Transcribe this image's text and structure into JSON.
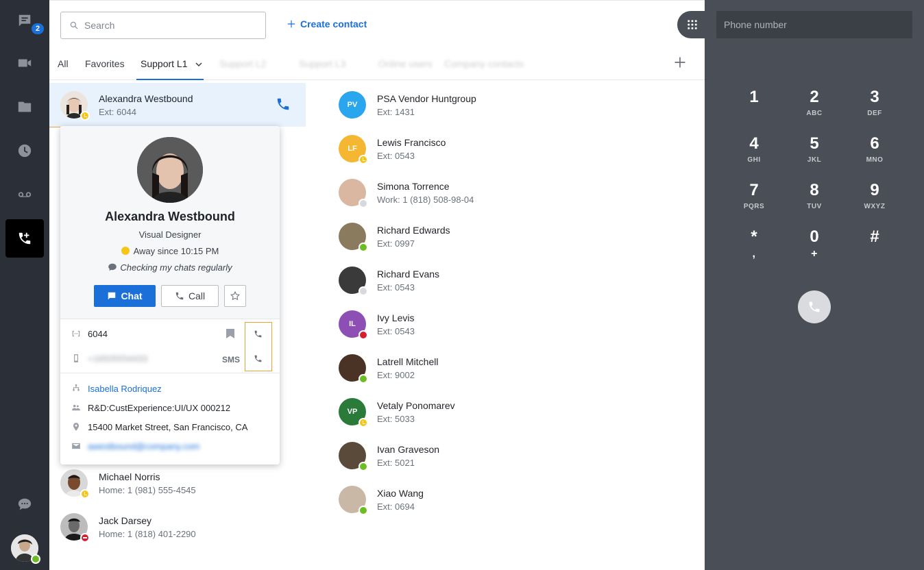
{
  "rail": {
    "chat_badge": "2"
  },
  "search": {
    "placeholder": "Search"
  },
  "create_contact": "Create contact",
  "tabs": [
    {
      "label": "All"
    },
    {
      "label": "Favorites"
    },
    {
      "label": "Support L1"
    },
    {
      "label": "Support L2"
    },
    {
      "label": "Support L3"
    },
    {
      "label": "Online users"
    },
    {
      "label": "Company contacts"
    }
  ],
  "left_contacts": [
    {
      "name": "Alexandra Westbound",
      "sub": "Ext: 6044",
      "status": "away"
    },
    {
      "name": "Michael Norris",
      "sub": "Home: 1 (981) 555-4545",
      "status": "away"
    },
    {
      "name": "Jack Darsey",
      "sub": "Home: 1 (818) 401-2290",
      "status": "dnd"
    }
  ],
  "right_contacts": [
    {
      "initials": "PV",
      "name": "PSA Vendor Huntgroup",
      "sub": "Ext: 1431",
      "color": "#2aa6ee",
      "status": "none"
    },
    {
      "initials": "LF",
      "name": "Lewis Francisco",
      "sub": "Ext: 0543",
      "color": "#f5b731",
      "status": "away"
    },
    {
      "initials": "",
      "name": "Simona Torrence",
      "sub": "Work: 1 (818) 508-98-04",
      "color": "#d9b7a0",
      "status": "grey"
    },
    {
      "initials": "",
      "name": "Richard Edwards",
      "sub": "Ext: 0997",
      "color": "#8a7a5e",
      "status": "green"
    },
    {
      "initials": "",
      "name": "Richard Evans",
      "sub": "Ext: 0543",
      "color": "#3a3a3a",
      "status": "grey"
    },
    {
      "initials": "IL",
      "name": "Ivy Levis",
      "sub": "Ext: 0543",
      "color": "#8e4fb5",
      "status": "call"
    },
    {
      "initials": "",
      "name": "Latrell Mitchell",
      "sub": "Ext: 9002",
      "color": "#4a3325",
      "status": "green"
    },
    {
      "initials": "VP",
      "name": "Vetaly Ponomarev",
      "sub": "Ext: 5033",
      "color": "#2a7a3a",
      "status": "away"
    },
    {
      "initials": "",
      "name": "Ivan Graveson",
      "sub": "Ext: 5021",
      "color": "#5a4a3a",
      "status": "green"
    },
    {
      "initials": "",
      "name": "Xiao Wang",
      "sub": "Ext: 0694",
      "color": "#c9b8a6",
      "status": "green"
    }
  ],
  "card": {
    "name": "Alexandra Westbound",
    "title": "Visual Designer",
    "status": "Away since 10:15 PM",
    "note": "Checking my chats regularly",
    "chat_label": "Chat",
    "call_label": "Call",
    "extension": "6044",
    "mobile": "+16505554433",
    "sms_label": "SMS",
    "manager": "Isabella Rodriquez",
    "department": "R&D:CustExperience:UI/UX 000212",
    "address": "15400 Market Street, San Francisco, CA",
    "email": "awestbound@company.com"
  },
  "dialer": {
    "placeholder": "Phone number",
    "keys": [
      {
        "d": "1",
        "l": ""
      },
      {
        "d": "2",
        "l": "ABC"
      },
      {
        "d": "3",
        "l": "DEF"
      },
      {
        "d": "4",
        "l": "GHI"
      },
      {
        "d": "5",
        "l": "JKL"
      },
      {
        "d": "6",
        "l": "MNO"
      },
      {
        "d": "7",
        "l": "PQRS"
      },
      {
        "d": "8",
        "l": "TUV"
      },
      {
        "d": "9",
        "l": "WXYZ"
      },
      {
        "d": "*",
        "l": ","
      },
      {
        "d": "0",
        "l": "+"
      },
      {
        "d": "#",
        "l": ""
      }
    ]
  }
}
